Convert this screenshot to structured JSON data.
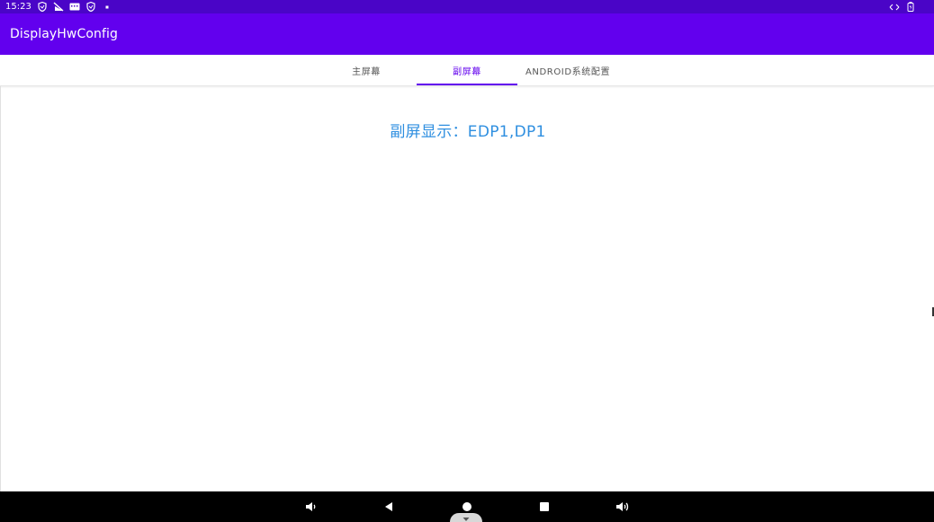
{
  "status_bar": {
    "time": "15:23",
    "left_icons": [
      "shield-icon",
      "muted-signal-icon",
      "keyboard-icon",
      "shield-icon",
      "dot-icon"
    ],
    "right_icons": [
      "data-transfer-icon",
      "battery-icon"
    ]
  },
  "app_bar": {
    "title": "DisplayHwConfig",
    "color": "#6200ee"
  },
  "tabs": [
    {
      "label": "主屏幕",
      "active": false
    },
    {
      "label": "副屏幕",
      "active": true
    },
    {
      "label": "ANDROID系统配置",
      "active": false
    }
  ],
  "content": {
    "display_text": "副屏显示：EDP1,DP1",
    "text_color": "#2f8fe0"
  },
  "nav_bar": {
    "buttons": [
      "volume-down-icon",
      "back-icon",
      "home-icon",
      "recents-icon",
      "volume-up-icon"
    ]
  }
}
